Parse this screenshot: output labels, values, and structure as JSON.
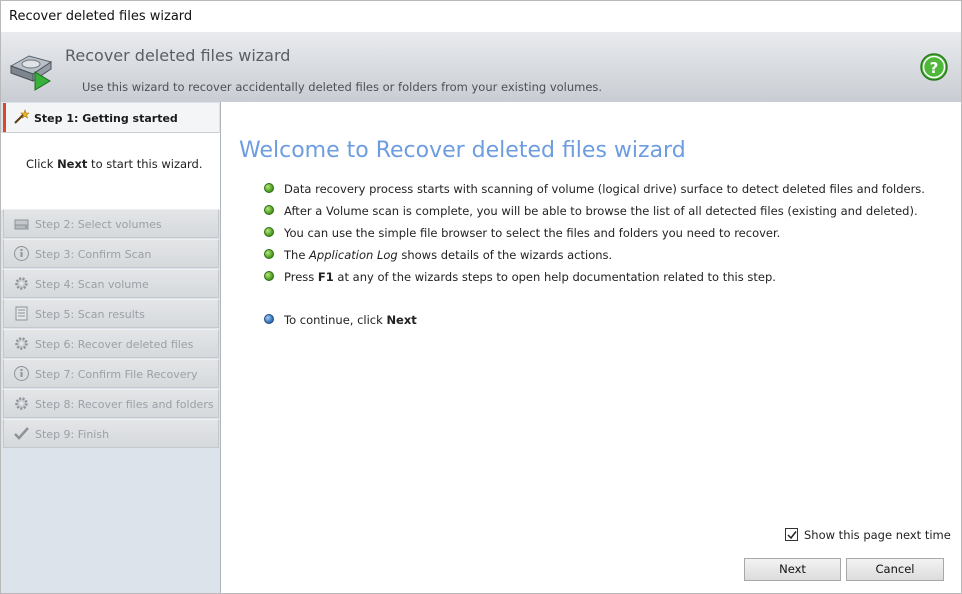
{
  "window": {
    "title": "Recover deleted files wizard"
  },
  "header": {
    "title": "Recover deleted files wizard",
    "subtitle": "Use this wizard to recover accidentally deleted files or folders from your existing volumes.",
    "logo_icon": "drive-recover-icon",
    "help_icon": "help-icon"
  },
  "sidebar": {
    "active_step": {
      "label": "Step 1: Getting started",
      "icon": "wand-icon"
    },
    "intro_prefix": "Click ",
    "intro_bold": "Next",
    "intro_suffix": " to start this wizard.",
    "steps": [
      {
        "label": "Step 2: Select volumes",
        "icon": "volumes-icon"
      },
      {
        "label": "Step 3: Confirm Scan",
        "icon": "info-icon"
      },
      {
        "label": "Step 4: Scan volume",
        "icon": "gear-icon"
      },
      {
        "label": "Step 5: Scan results",
        "icon": "list-icon"
      },
      {
        "label": "Step 6: Recover deleted files",
        "icon": "gear-icon"
      },
      {
        "label": "Step 7: Confirm File Recovery",
        "icon": "info-icon"
      },
      {
        "label": "Step 8: Recover files and folders",
        "icon": "gear-icon"
      },
      {
        "label": "Step 9: Finish",
        "icon": "check-icon"
      }
    ]
  },
  "main": {
    "welcome": "Welcome to Recover deleted files wizard",
    "bullets": [
      {
        "text": "Data recovery process starts with scanning of volume (logical drive) surface to detect deleted files and folders."
      },
      {
        "text": "After a Volume scan is complete, you will be able to browse the list of all detected files (existing and deleted)."
      },
      {
        "text": "You can use the simple file browser to select the files and folders you need to recover."
      },
      {
        "pre": "The ",
        "em": "Application Log",
        "post": " shows details of the wizards actions."
      },
      {
        "pre": "Press ",
        "strong": "F1",
        "post": " at any of the wizards steps to open help documentation related to this step."
      }
    ],
    "continue_prefix": "To continue, click ",
    "continue_bold": "Next",
    "show_page_label": "Show this page next time",
    "show_page_checked": true,
    "next_label": "Next",
    "cancel_label": "Cancel"
  },
  "colors": {
    "welcome": "#6d9de0",
    "active_step_bar": "#d94a2a",
    "sidebar_bg": "#dde3ea"
  }
}
